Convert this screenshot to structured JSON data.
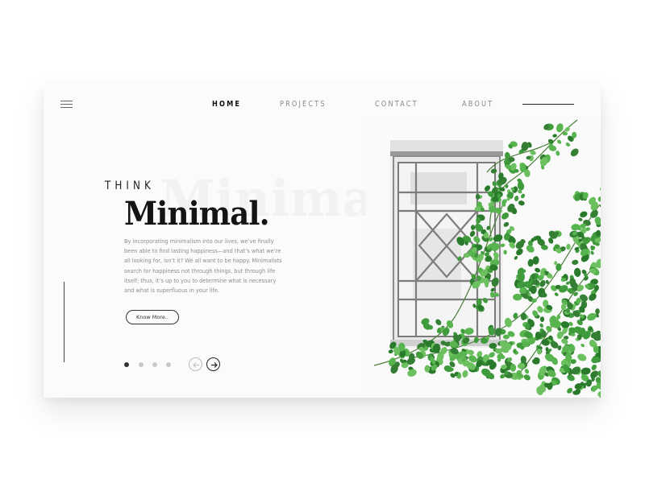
{
  "nav": {
    "items": [
      {
        "label": "HOME",
        "active": true
      },
      {
        "label": "PROJECTS",
        "active": false
      },
      {
        "label": "CONTACT",
        "active": false
      },
      {
        "label": "ABOUT",
        "active": false
      }
    ]
  },
  "hero": {
    "eyebrow": "THINK",
    "title": "Minimal.",
    "ghost_text": "Minimal.",
    "body": "By incorporating minimalism into our lives, we’ve finally been able to find lasting happiness—and that’s what we’re all looking for, isn’t it? We all want to be happy. Minimalists search for happiness not through things, but through life itself; thus, it’s up to you to determine what is necessary and what is superfluous in your life.",
    "button_label": "Know More.."
  },
  "slider": {
    "dots": 4,
    "active_index": 0
  },
  "colors": {
    "accent": "#111111",
    "muted": "#8a8a8a",
    "leaf": "#3f9b3c",
    "leaf_dark": "#2a7a2c"
  },
  "icons": [
    "menu-icon",
    "arrow-left-icon",
    "arrow-right-icon"
  ]
}
